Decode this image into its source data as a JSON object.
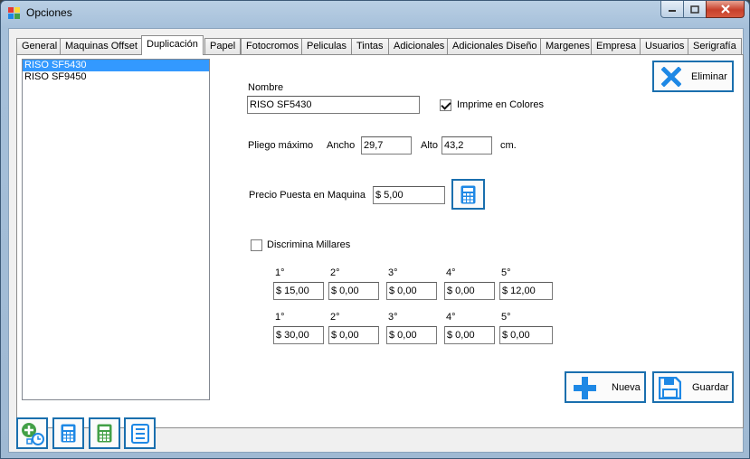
{
  "window": {
    "title": "Opciones",
    "icon": "app-window-icon"
  },
  "tabs": [
    {
      "label": "General"
    },
    {
      "label": "Maquinas Offset"
    },
    {
      "label": "Duplicación"
    },
    {
      "label": "Papel"
    },
    {
      "label": "Fotocromos"
    },
    {
      "label": "Peliculas"
    },
    {
      "label": "Tintas"
    },
    {
      "label": "Adicionales"
    },
    {
      "label": "Adicionales Diseño"
    },
    {
      "label": "Margenes"
    },
    {
      "label": "Empresa"
    },
    {
      "label": "Usuarios"
    },
    {
      "label": "Serigrafía"
    }
  ],
  "active_tab": "Duplicación",
  "machines": {
    "items": [
      {
        "label": "RISO SF5430",
        "selected": true
      },
      {
        "label": "RISO SF9450",
        "selected": false
      }
    ]
  },
  "form": {
    "nombre_label": "Nombre",
    "nombre_value": "RISO SF5430",
    "imprime_label": "Imprime en Colores",
    "imprime_checked": true,
    "pliego_label": "Pliego máximo",
    "ancho_label": "Ancho",
    "ancho_value": "29,7",
    "alto_label": "Alto",
    "alto_value": "43,2",
    "unit": "cm.",
    "precio_label": "Precio Puesta en Maquina",
    "precio_value": "$ 5,00",
    "discrimina_label": "Discrimina Millares",
    "discrimina_checked": false,
    "row1": {
      "headers": [
        "1°",
        "2°",
        "3°",
        "4°",
        "5°"
      ],
      "values": [
        "$ 15,00",
        "$ 0,00",
        "$ 0,00",
        "$ 0,00",
        "$ 12,00"
      ]
    },
    "row2": {
      "headers": [
        "1°",
        "2°",
        "3°",
        "4°",
        "5°"
      ],
      "values": [
        "$ 30,00",
        "$ 0,00",
        "$ 0,00",
        "$ 0,00",
        "$ 0,00"
      ]
    }
  },
  "buttons": {
    "eliminar": "Eliminar",
    "nueva": "Nueva",
    "guardar": "Guardar"
  },
  "colors": {
    "accent": "#1a6fae",
    "icon_blue": "#1e88e5",
    "icon_green": "#43a047",
    "selection": "#3399ff"
  }
}
